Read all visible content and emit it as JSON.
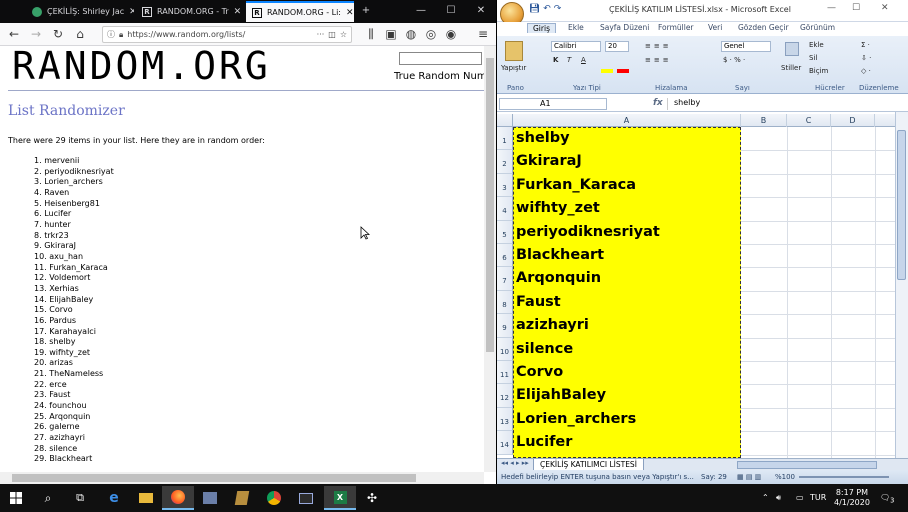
{
  "firefox": {
    "tabs": [
      {
        "label": "ÇEKİLİŞ: Shirley Jac",
        "active": false
      },
      {
        "label": "RANDOM.ORG - Tr",
        "active": false
      },
      {
        "label": "RANDOM.ORG - Li:",
        "active": true
      }
    ],
    "new_tab": "+",
    "window_controls": {
      "minimize": "—",
      "maximize": "☐",
      "close": "✕"
    },
    "url": "https://www.random.org/lists/",
    "url_menu": "···"
  },
  "random_org": {
    "logo": "RANDOM.ORG",
    "tagline": "True Random Numb",
    "heading": "List Randomizer",
    "intro": "There were 29 items in your list. Here they are in random order:",
    "items": [
      "mervenii",
      "periyodiknesriyat",
      "Lorien_archers",
      "Raven",
      "Heisenberg81",
      "Lucifer",
      "hunter",
      "trkr23",
      "GkiraraJ",
      "axu_han",
      "Furkan_Karaca",
      "Voldemort",
      "Xerhias",
      "ElijahBaley",
      "Corvo",
      "Pardus",
      "Karahayalci",
      "shelby",
      "wifhty_zet",
      "arizas",
      "TheNameless",
      "erce",
      "Faust",
      "founchou",
      "Arqonquin",
      "galerne",
      "azizhayri",
      "silence",
      "Blackheart"
    ]
  },
  "excel": {
    "title": "ÇEKİLİŞ KATILIM LİSTESİ.xlsx - Microsoft Excel",
    "tabs": [
      "Giriş",
      "Ekle",
      "Sayfa Düzeni",
      "Formüller",
      "Veri",
      "Gözden Geçir",
      "Görünüm"
    ],
    "ribbon": {
      "paste": "Yapıştır",
      "font_name": "Calibri",
      "font_size": "20",
      "number_format": "Genel",
      "styles": "Stiller",
      "insert": "Ekle",
      "delete": "Sil",
      "format": "Biçim",
      "groups": [
        "Pano",
        "Yazı Tipi",
        "Hizalama",
        "Sayı",
        "Hücreler",
        "Düzenleme"
      ]
    },
    "name_box": "A1",
    "fx": "fx",
    "formula": "shelby",
    "columns": [
      "A",
      "B",
      "C",
      "D"
    ],
    "rows": [
      {
        "n": "1",
        "value": "shelby"
      },
      {
        "n": "2",
        "value": "GkiraraJ"
      },
      {
        "n": "3",
        "value": "Furkan_Karaca"
      },
      {
        "n": "4",
        "value": "wifhty_zet"
      },
      {
        "n": "5",
        "value": "periyodiknesriyat"
      },
      {
        "n": "6",
        "value": "Blackheart"
      },
      {
        "n": "7",
        "value": "Arqonquin"
      },
      {
        "n": "8",
        "value": "Faust"
      },
      {
        "n": "9",
        "value": "azizhayri"
      },
      {
        "n": "10",
        "value": "silence"
      },
      {
        "n": "11",
        "value": "Corvo"
      },
      {
        "n": "12",
        "value": "ElijahBaley"
      },
      {
        "n": "13",
        "value": "Lorien_archers"
      },
      {
        "n": "14",
        "value": "Lucifer"
      }
    ],
    "sheet_tab": "ÇEKİLİŞ KATILIMCI LİSTESİ",
    "status_left": "Hedefi belirleyip ENTER tuşuna basın veya Yapıştır'ı s...",
    "status_count": "Say: 29",
    "zoom": "%100"
  },
  "taskbar": {
    "language": "TUR",
    "time": "8:17 PM",
    "date": "4/1/2020",
    "notifications": "3"
  },
  "colors": {
    "highlight": "#ffff00",
    "heading": "#6b73c6",
    "firefox_dark": "#0c0c0d",
    "excel_ribbon": "#d7e3f2"
  }
}
